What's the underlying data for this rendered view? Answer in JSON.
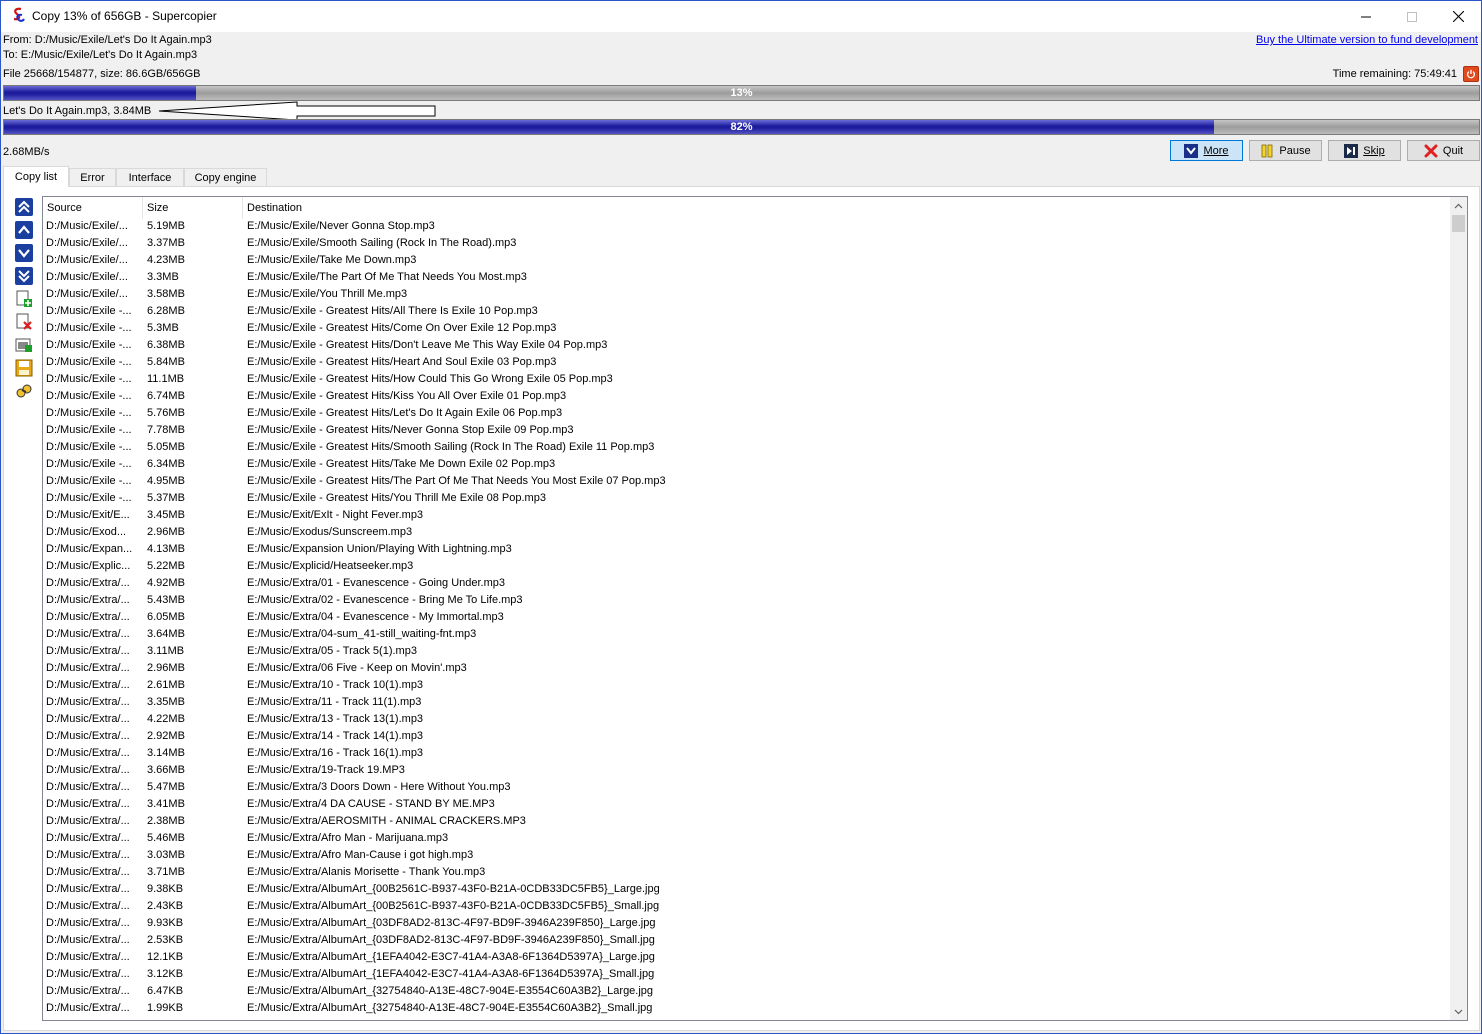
{
  "window": {
    "title": "Copy 13% of 656GB - Supercopier"
  },
  "info": {
    "from": "From: D:/Music/Exile/Let's Do It Again.mp3",
    "to": "To:  E:/Music/Exile/Let's Do It Again.mp3",
    "file_stats": "File 25668/154877, size: 86.6GB/656GB",
    "ultimate_link": "Buy the Ultimate version to fund development",
    "time_remaining": "Time remaining: 75:49:41"
  },
  "overall_progress": {
    "label": "13%",
    "value": 0.13
  },
  "current_file": "Let's Do It Again.mp3, 3.84MB",
  "file_progress": {
    "label": "82%",
    "value": 0.82
  },
  "speed": "2.68MB/s",
  "buttons": {
    "more": "More",
    "pause": "Pause",
    "skip": "Skip",
    "quit": "Quit"
  },
  "tabs": [
    "Copy list",
    "Error",
    "Interface",
    "Copy engine"
  ],
  "side_tools": [
    "move-top-icon",
    "move-up-icon",
    "move-down-icon",
    "move-bottom-icon",
    "add-file-icon",
    "delete-file-icon",
    "add-folder-icon",
    "save-icon",
    "search-icon"
  ],
  "columns": [
    "Source",
    "Size",
    "Destination"
  ],
  "rows": [
    {
      "src": "D:/Music/Exile/...",
      "size": "5.19MB",
      "dst": "E:/Music/Exile/Never Gonna Stop.mp3"
    },
    {
      "src": "D:/Music/Exile/...",
      "size": "3.37MB",
      "dst": "E:/Music/Exile/Smooth Sailing (Rock In The Road).mp3"
    },
    {
      "src": "D:/Music/Exile/...",
      "size": "4.23MB",
      "dst": "E:/Music/Exile/Take Me Down.mp3"
    },
    {
      "src": "D:/Music/Exile/...",
      "size": "3.3MB",
      "dst": "E:/Music/Exile/The Part Of Me That Needs You Most.mp3"
    },
    {
      "src": "D:/Music/Exile/...",
      "size": "3.58MB",
      "dst": "E:/Music/Exile/You Thrill Me.mp3"
    },
    {
      "src": "D:/Music/Exile -...",
      "size": "6.28MB",
      "dst": "E:/Music/Exile - Greatest Hits/All There Is Exile 10 Pop.mp3"
    },
    {
      "src": "D:/Music/Exile -...",
      "size": "5.3MB",
      "dst": "E:/Music/Exile - Greatest Hits/Come On Over Exile 12 Pop.mp3"
    },
    {
      "src": "D:/Music/Exile -...",
      "size": "6.38MB",
      "dst": "E:/Music/Exile - Greatest Hits/Don't Leave Me This Way Exile 04 Pop.mp3"
    },
    {
      "src": "D:/Music/Exile -...",
      "size": "5.84MB",
      "dst": "E:/Music/Exile - Greatest Hits/Heart And Soul Exile 03 Pop.mp3"
    },
    {
      "src": "D:/Music/Exile -...",
      "size": "11.1MB",
      "dst": "E:/Music/Exile - Greatest Hits/How Could This Go Wrong Exile 05 Pop.mp3"
    },
    {
      "src": "D:/Music/Exile -...",
      "size": "6.74MB",
      "dst": "E:/Music/Exile - Greatest Hits/Kiss You All Over Exile 01 Pop.mp3"
    },
    {
      "src": "D:/Music/Exile -...",
      "size": "5.76MB",
      "dst": "E:/Music/Exile - Greatest Hits/Let's Do It Again Exile 06 Pop.mp3"
    },
    {
      "src": "D:/Music/Exile -...",
      "size": "7.78MB",
      "dst": "E:/Music/Exile - Greatest Hits/Never Gonna Stop Exile 09 Pop.mp3"
    },
    {
      "src": "D:/Music/Exile -...",
      "size": "5.05MB",
      "dst": "E:/Music/Exile - Greatest Hits/Smooth Sailing (Rock In The Road) Exile 11 Pop.mp3"
    },
    {
      "src": "D:/Music/Exile -...",
      "size": "6.34MB",
      "dst": "E:/Music/Exile - Greatest Hits/Take Me Down Exile 02 Pop.mp3"
    },
    {
      "src": "D:/Music/Exile -...",
      "size": "4.95MB",
      "dst": "E:/Music/Exile - Greatest Hits/The Part Of Me That Needs You Most Exile 07 Pop.mp3"
    },
    {
      "src": "D:/Music/Exile -...",
      "size": "5.37MB",
      "dst": "E:/Music/Exile - Greatest Hits/You Thrill Me Exile 08 Pop.mp3"
    },
    {
      "src": "D:/Music/Exit/E...",
      "size": "3.45MB",
      "dst": "E:/Music/Exit/ExIt - Night Fever.mp3"
    },
    {
      "src": "D:/Music/Exod...",
      "size": "2.96MB",
      "dst": "E:/Music/Exodus/Sunscreem.mp3"
    },
    {
      "src": "D:/Music/Expan...",
      "size": "4.13MB",
      "dst": "E:/Music/Expansion Union/Playing With Lightning.mp3"
    },
    {
      "src": "D:/Music/Explic...",
      "size": "5.22MB",
      "dst": "E:/Music/Explicid/Heatseeker.mp3"
    },
    {
      "src": "D:/Music/Extra/...",
      "size": "4.92MB",
      "dst": "E:/Music/Extra/01 - Evanescence - Going Under.mp3"
    },
    {
      "src": "D:/Music/Extra/...",
      "size": "5.43MB",
      "dst": "E:/Music/Extra/02 - Evanescence - Bring Me To Life.mp3"
    },
    {
      "src": "D:/Music/Extra/...",
      "size": "6.05MB",
      "dst": "E:/Music/Extra/04 - Evanescence - My Immortal.mp3"
    },
    {
      "src": "D:/Music/Extra/...",
      "size": "3.64MB",
      "dst": "E:/Music/Extra/04-sum_41-still_waiting-fnt.mp3"
    },
    {
      "src": "D:/Music/Extra/...",
      "size": "3.11MB",
      "dst": "E:/Music/Extra/05 - Track 5(1).mp3"
    },
    {
      "src": "D:/Music/Extra/...",
      "size": "2.96MB",
      "dst": "E:/Music/Extra/06 Five - Keep on Movin'.mp3"
    },
    {
      "src": "D:/Music/Extra/...",
      "size": "2.61MB",
      "dst": "E:/Music/Extra/10 - Track 10(1).mp3"
    },
    {
      "src": "D:/Music/Extra/...",
      "size": "3.35MB",
      "dst": "E:/Music/Extra/11 - Track 11(1).mp3"
    },
    {
      "src": "D:/Music/Extra/...",
      "size": "4.22MB",
      "dst": "E:/Music/Extra/13 - Track 13(1).mp3"
    },
    {
      "src": "D:/Music/Extra/...",
      "size": "2.92MB",
      "dst": "E:/Music/Extra/14 - Track 14(1).mp3"
    },
    {
      "src": "D:/Music/Extra/...",
      "size": "3.14MB",
      "dst": "E:/Music/Extra/16 - Track 16(1).mp3"
    },
    {
      "src": "D:/Music/Extra/...",
      "size": "3.66MB",
      "dst": "E:/Music/Extra/19-Track 19.MP3"
    },
    {
      "src": "D:/Music/Extra/...",
      "size": "5.47MB",
      "dst": "E:/Music/Extra/3 Doors Down - Here Without You.mp3"
    },
    {
      "src": "D:/Music/Extra/...",
      "size": "3.41MB",
      "dst": "E:/Music/Extra/4 DA CAUSE - STAND BY ME.MP3"
    },
    {
      "src": "D:/Music/Extra/...",
      "size": "2.38MB",
      "dst": "E:/Music/Extra/AEROSMITH - ANIMAL CRACKERS.MP3"
    },
    {
      "src": "D:/Music/Extra/...",
      "size": "5.46MB",
      "dst": "E:/Music/Extra/Afro Man - Marijuana.mp3"
    },
    {
      "src": "D:/Music/Extra/...",
      "size": "3.03MB",
      "dst": "E:/Music/Extra/Afro Man-Cause i got high.mp3"
    },
    {
      "src": "D:/Music/Extra/...",
      "size": "3.71MB",
      "dst": "E:/Music/Extra/Alanis Morisette - Thank You.mp3"
    },
    {
      "src": "D:/Music/Extra/...",
      "size": "9.38KB",
      "dst": "E:/Music/Extra/AlbumArt_{00B2561C-B937-43F0-B21A-0CDB33DC5FB5}_Large.jpg"
    },
    {
      "src": "D:/Music/Extra/...",
      "size": "2.43KB",
      "dst": "E:/Music/Extra/AlbumArt_{00B2561C-B937-43F0-B21A-0CDB33DC5FB5}_Small.jpg"
    },
    {
      "src": "D:/Music/Extra/...",
      "size": "9.93KB",
      "dst": "E:/Music/Extra/AlbumArt_{03DF8AD2-813C-4F97-BD9F-3946A239F850}_Large.jpg"
    },
    {
      "src": "D:/Music/Extra/...",
      "size": "2.53KB",
      "dst": "E:/Music/Extra/AlbumArt_{03DF8AD2-813C-4F97-BD9F-3946A239F850}_Small.jpg"
    },
    {
      "src": "D:/Music/Extra/...",
      "size": "12.1KB",
      "dst": "E:/Music/Extra/AlbumArt_{1EFA4042-E3C7-41A4-A3A8-6F1364D5397A}_Large.jpg"
    },
    {
      "src": "D:/Music/Extra/...",
      "size": "3.12KB",
      "dst": "E:/Music/Extra/AlbumArt_{1EFA4042-E3C7-41A4-A3A8-6F1364D5397A}_Small.jpg"
    },
    {
      "src": "D:/Music/Extra/...",
      "size": "6.47KB",
      "dst": "E:/Music/Extra/AlbumArt_{32754840-A13E-48C7-904E-E3554C60A3B2}_Large.jpg"
    },
    {
      "src": "D:/Music/Extra/...",
      "size": "1.99KB",
      "dst": "E:/Music/Extra/AlbumArt_{32754840-A13E-48C7-904E-E3554C60A3B2}_Small.jpg"
    }
  ]
}
